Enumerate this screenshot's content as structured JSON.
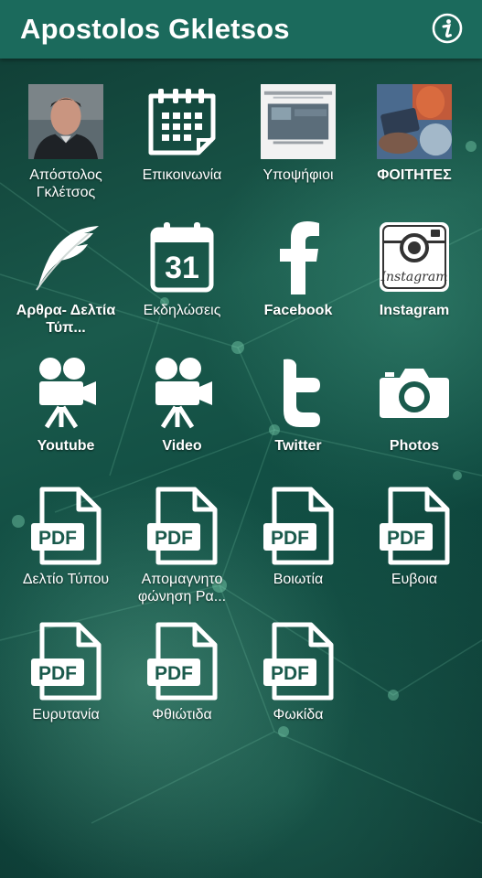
{
  "header": {
    "title": "Apostolos Gkletsos"
  },
  "tiles": [
    {
      "label": "Απόστολος Γκλέτσος",
      "icon": "portrait-photo"
    },
    {
      "label": "Επικοινωνία",
      "icon": "calendar-icon"
    },
    {
      "label": "Υποψήφιοι",
      "icon": "candidates-photo",
      "photo_text": "Απόστολος Γκλέτσος"
    },
    {
      "label": "ΦΟΙΤΗΤΕΣ",
      "icon": "students-photo"
    },
    {
      "label": "Αρθρα- Δελτία Τύπ...",
      "icon": "feather-icon"
    },
    {
      "label": "Εκδηλώσεις",
      "icon": "calendar-31-icon",
      "day": "31"
    },
    {
      "label": "Facebook",
      "icon": "facebook-icon",
      "glyph": "f"
    },
    {
      "label": "Instagram",
      "icon": "instagram-icon",
      "glyph": "Instagram"
    },
    {
      "label": "Youtube",
      "icon": "video-camera-icon"
    },
    {
      "label": "Video",
      "icon": "video-camera-icon"
    },
    {
      "label": "Twitter",
      "icon": "twitter-icon",
      "glyph": "t"
    },
    {
      "label": "Photos",
      "icon": "camera-icon"
    },
    {
      "label": "Δελτίο Τύπου",
      "icon": "pdf-icon"
    },
    {
      "label": "Απομαγνητο φώνηση Ρα...",
      "icon": "pdf-icon"
    },
    {
      "label": "Βοιωτία",
      "icon": "pdf-icon"
    },
    {
      "label": "Ευβοια",
      "icon": "pdf-icon"
    },
    {
      "label": "Ευρυτανία",
      "icon": "pdf-icon"
    },
    {
      "label": "Φθιώτιδα",
      "icon": "pdf-icon"
    },
    {
      "label": "Φωκίδα",
      "icon": "pdf-icon"
    }
  ],
  "pdf_badge": "PDF",
  "colors": {
    "header": "#1b6a5c",
    "icon": "#ffffff",
    "background": "#134b41"
  }
}
